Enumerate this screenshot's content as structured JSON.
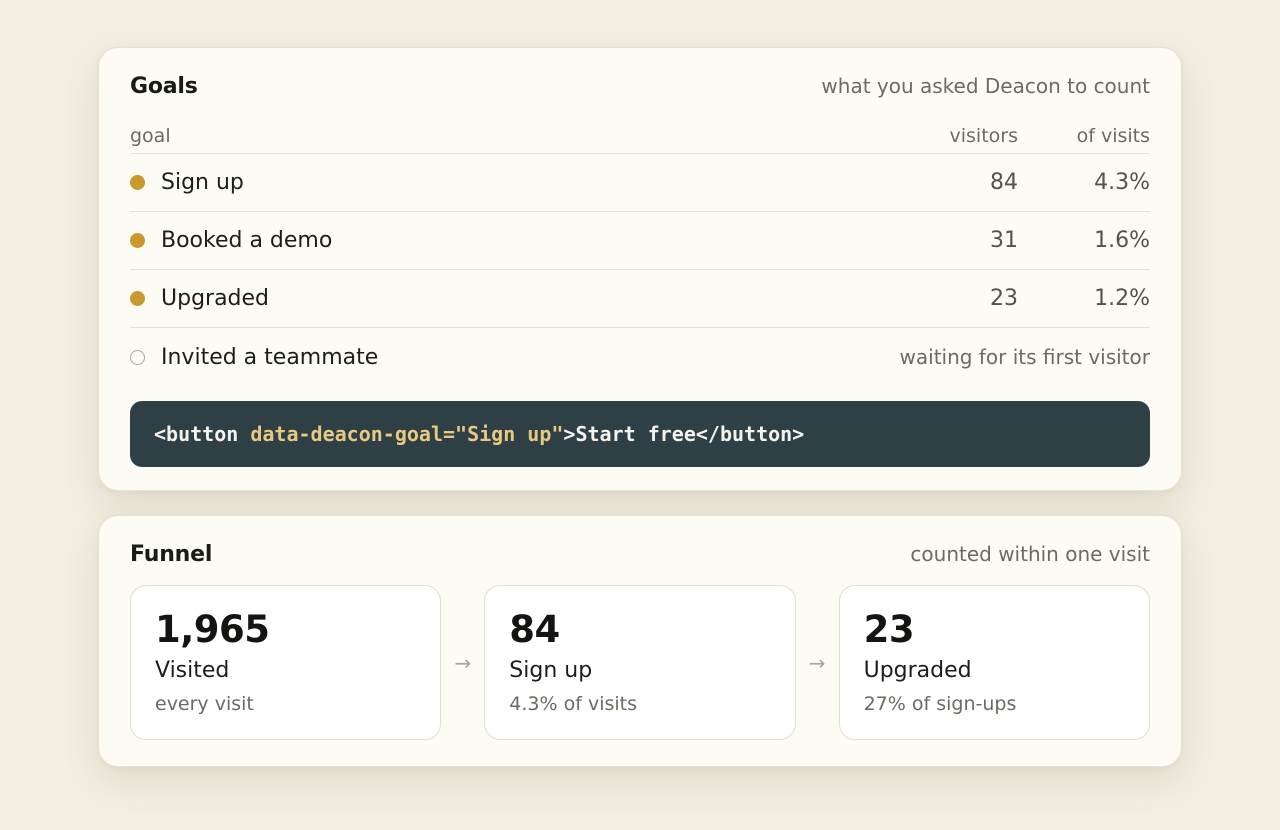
{
  "goals": {
    "title": "Goals",
    "subtitle": "what you asked Deacon to count",
    "columns": {
      "goal": "goal",
      "visitors": "visitors",
      "pct": "of visits"
    },
    "rows": [
      {
        "name": "Sign up",
        "visitors": "84",
        "pct": "4.3%"
      },
      {
        "name": "Booked a demo",
        "visitors": "31",
        "pct": "1.6%"
      },
      {
        "name": "Upgraded",
        "visitors": "23",
        "pct": "1.2%"
      }
    ],
    "pending": {
      "name": "Invited a teammate",
      "status": "waiting for its first visitor"
    },
    "snippet": {
      "open": "<button ",
      "attr": "data-deacon-goal=\"Sign up\"",
      "rest": ">Start free</button>"
    }
  },
  "funnel": {
    "title": "Funnel",
    "subtitle": "counted within one visit",
    "arrow": "→",
    "steps": [
      {
        "value": "1,965",
        "label": "Visited",
        "sub": "every visit"
      },
      {
        "value": "84",
        "label": "Sign up",
        "sub": "4.3% of visits"
      },
      {
        "value": "23",
        "label": "Upgraded",
        "sub": "27% of sign-ups"
      }
    ]
  },
  "colors": {
    "background": "#f2eee2",
    "card": "#fdfcf4",
    "accent_dot": "#c9992f",
    "code_bg": "#2e4045",
    "code_attr": "#e7c982"
  }
}
